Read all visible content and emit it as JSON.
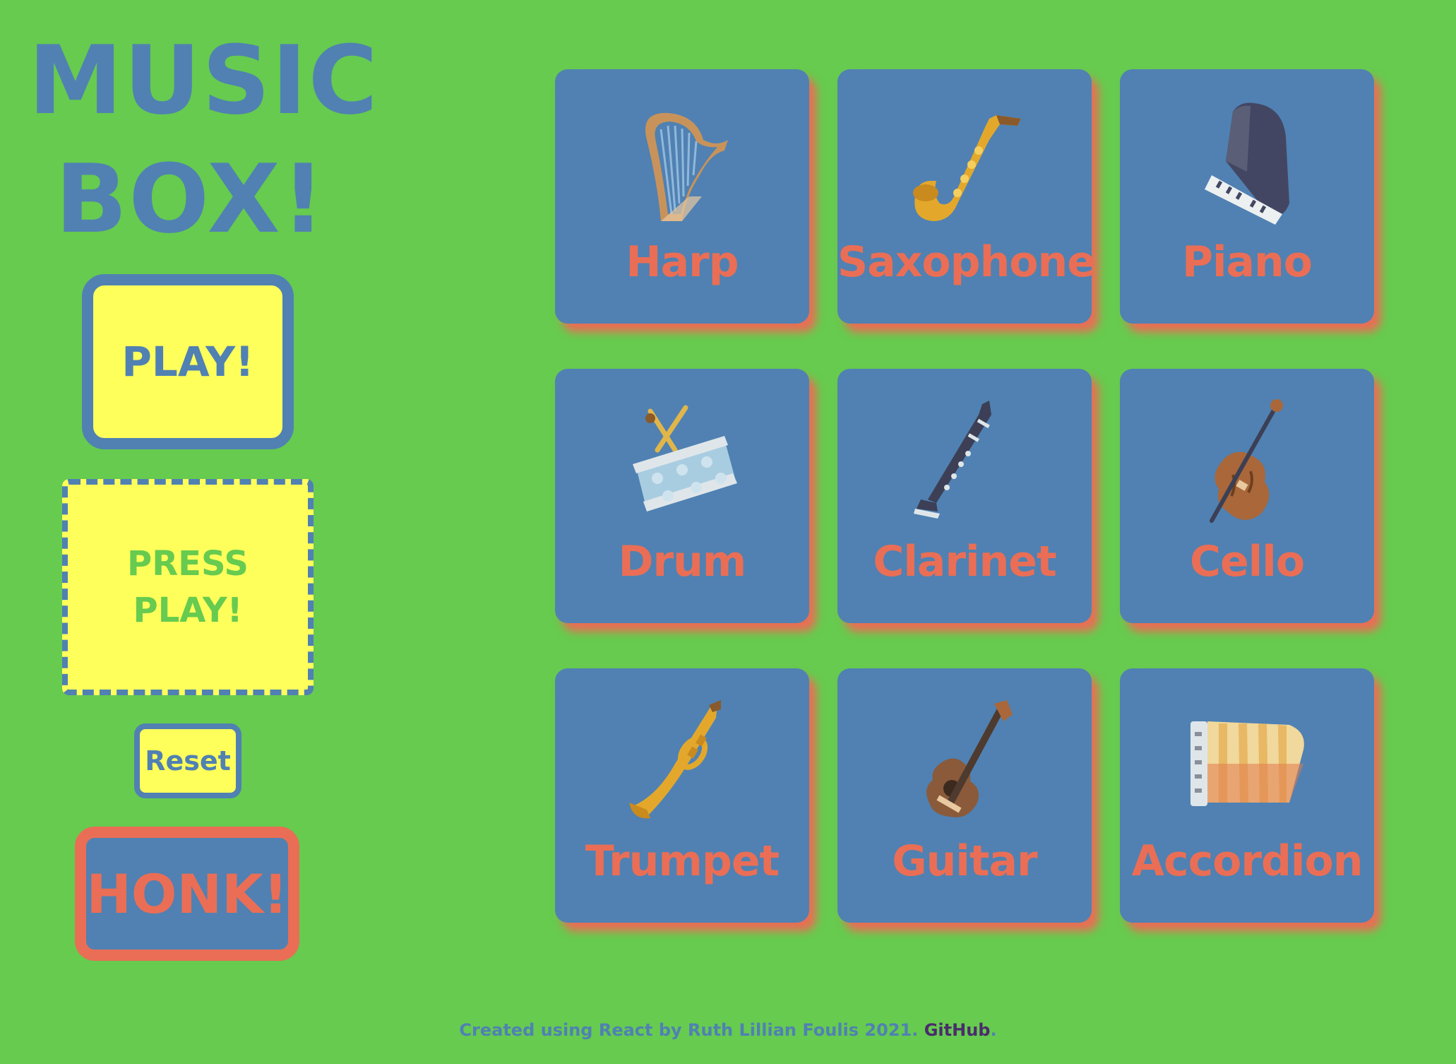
{
  "title": {
    "line1": "MUSIC",
    "line2": "BOX!"
  },
  "controls": {
    "play_label": "PLAY!",
    "display_line1": "PRESS",
    "display_line2": "PLAY!",
    "reset_label": "Reset",
    "honk_label": "HONK!"
  },
  "instruments": [
    {
      "label": "Harp",
      "icon": "harp-icon"
    },
    {
      "label": "Saxophone",
      "icon": "saxophone-icon"
    },
    {
      "label": "Piano",
      "icon": "piano-icon"
    },
    {
      "label": "Drum",
      "icon": "drum-icon"
    },
    {
      "label": "Clarinet",
      "icon": "clarinet-icon"
    },
    {
      "label": "Cello",
      "icon": "cello-icon"
    },
    {
      "label": "Trumpet",
      "icon": "trumpet-icon"
    },
    {
      "label": "Guitar",
      "icon": "guitar-icon"
    },
    {
      "label": "Accordion",
      "icon": "accordion-icon"
    }
  ],
  "footer": {
    "text": "Created using React by Ruth Lillian Foulis 2021.",
    "link": "GitHub",
    "period": "."
  },
  "colors": {
    "background": "#66cb4f",
    "blue": "#5081b2",
    "yellow": "#ffff5c",
    "coral": "#ea6e55"
  }
}
